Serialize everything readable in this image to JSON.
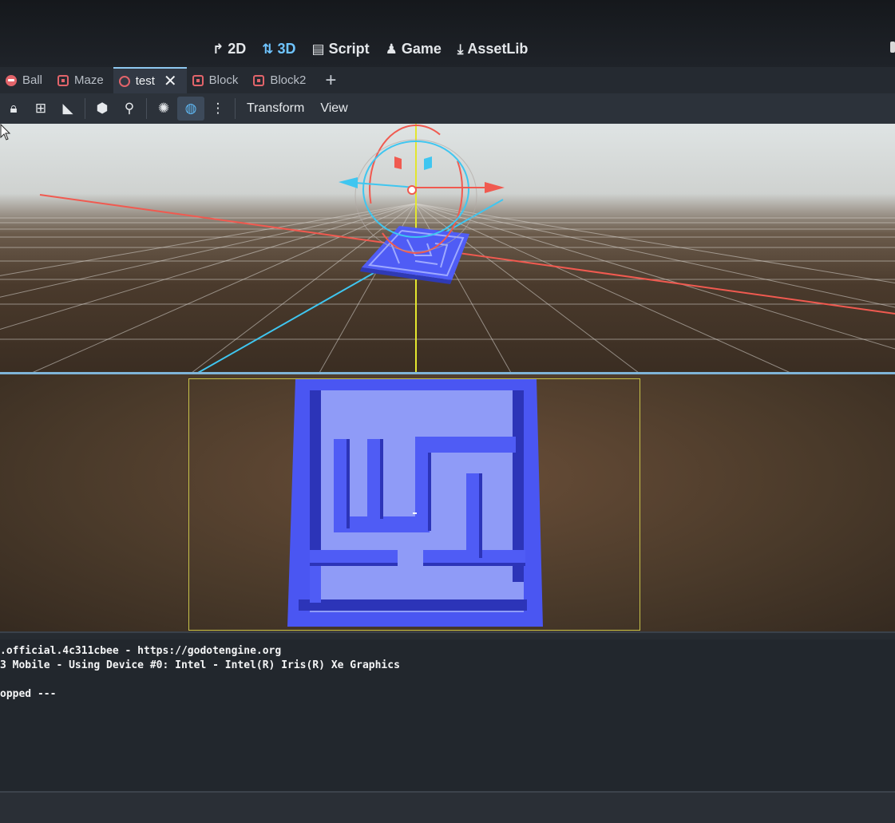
{
  "workspaces": [
    {
      "label": "2D",
      "icon": "2d-arrows-icon",
      "active": false
    },
    {
      "label": "3D",
      "icon": "3d-arrows-icon",
      "active": true
    },
    {
      "label": "Script",
      "icon": "script-icon",
      "active": false
    },
    {
      "label": "Game",
      "icon": "game-icon",
      "active": false
    },
    {
      "label": "AssetLib",
      "icon": "download-icon",
      "active": false
    }
  ],
  "tabs": [
    {
      "label": "Ball",
      "icon": "ball-scene-icon"
    },
    {
      "label": "Maze",
      "icon": "node3d-scene-icon"
    },
    {
      "label": "test",
      "icon": "ring-scene-icon",
      "active": true,
      "close": "✕"
    },
    {
      "label": "Block",
      "icon": "node3d-scene-icon"
    },
    {
      "label": "Block2",
      "icon": "node3d-scene-icon"
    }
  ],
  "tab_add": "+",
  "toolbar": {
    "tools": [
      "lock-icon",
      "group-icon",
      "ruler-icon",
      "cube-icon",
      "snap-icon",
      "sun-icon",
      "globe-icon",
      "more-icon"
    ],
    "active_tool": "globe-icon",
    "menus": [
      "Transform",
      "View"
    ]
  },
  "output": {
    "lines": [
      ".official.4c311cbee - https://godotengine.org",
      "3 Mobile - Using Device #0: Intel - Intel(R) Iris(R) Xe Graphics",
      "",
      "opped ---"
    ]
  },
  "colors": {
    "axis_x": "#f05a50",
    "axis_y": "#e3e62e",
    "axis_z": "#3fc6f0",
    "maze": "#4f5cf5",
    "camera_frame": "#c7c24a",
    "active_workspace": "#6fc4ff"
  }
}
